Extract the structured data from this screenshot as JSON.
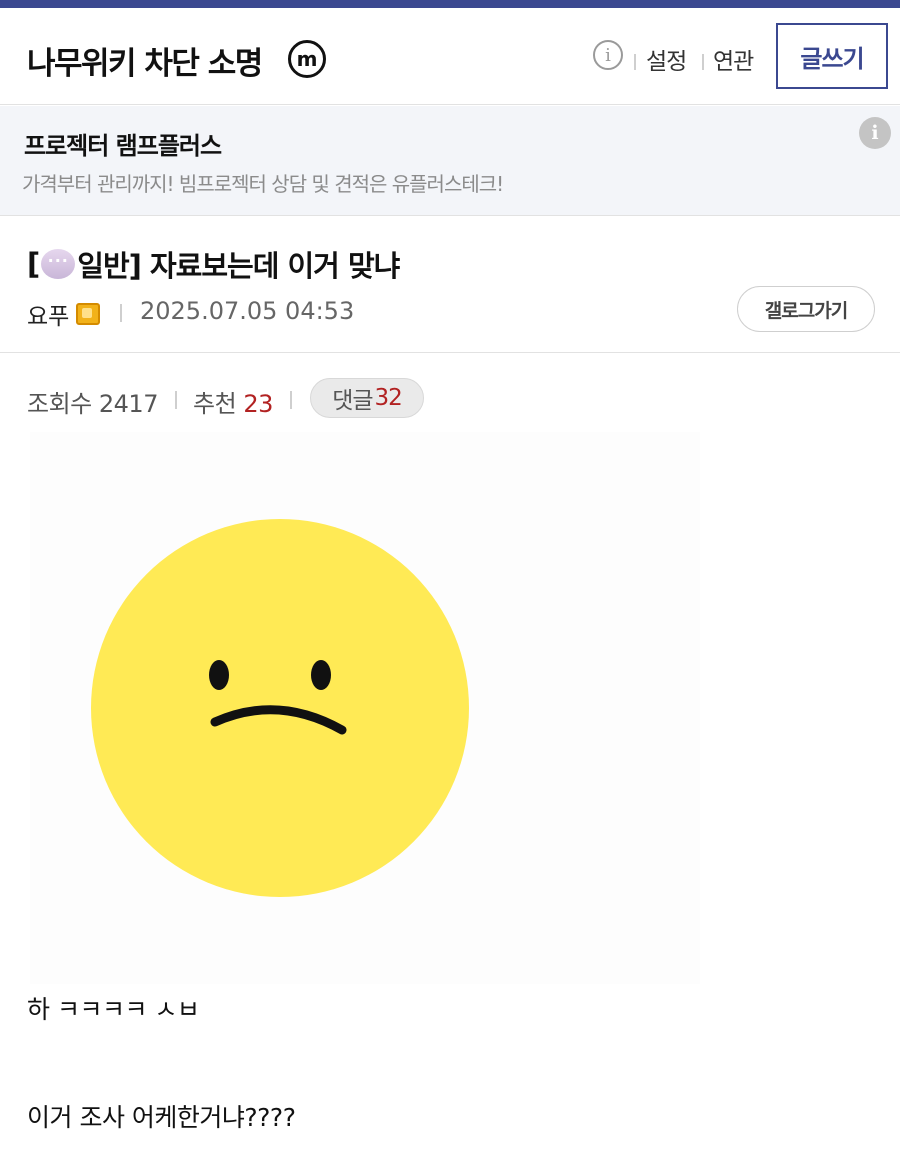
{
  "header": {
    "gallery_title": "나무위키 차단 소명",
    "minor_badge": "m",
    "info_icon": "ⓘ",
    "settings_label": "설정",
    "related_label": "연관",
    "write_label": "글쓰기"
  },
  "ad": {
    "title": "프로젝터 램프플러스",
    "description": "가격부터 관리까지! 빔프로젝터 상담 및 견적은 유플러스테크!",
    "info_icon": "i"
  },
  "post": {
    "title_prefix": "[",
    "category": "일반",
    "title_suffix": "] 자료보는데 이거 맞냐",
    "author": "요푸",
    "date": "2025.07.05 04:53",
    "gallery_button": "갤로그가기",
    "views_label": "조회수",
    "views": "2417",
    "recommend_label": "추천",
    "recommend": "23",
    "comments_label": "댓글",
    "comments": "32",
    "image_icon": "sad-face",
    "body_lines": [
      "하 ㅋㅋㅋㅋ ㅅㅂ",
      "이거 조사 어케한거냐????"
    ]
  },
  "colors": {
    "brand": "#3b4890",
    "count_red": "#b22222",
    "face_yellow": "#ffea55"
  }
}
